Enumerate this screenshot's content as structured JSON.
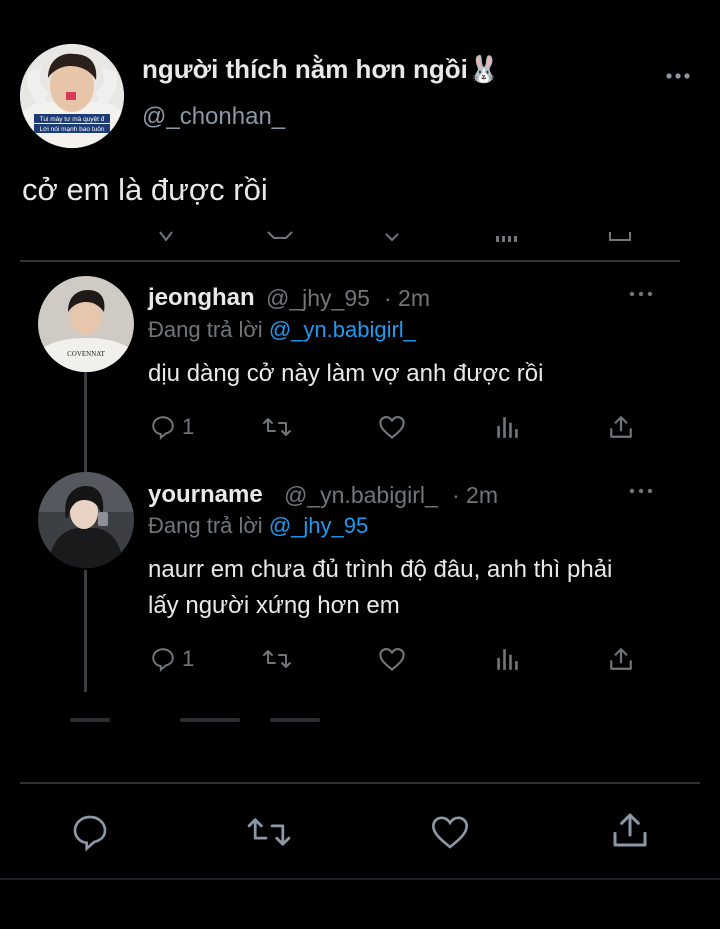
{
  "main_tweet": {
    "display_name": "người thích nằm hơn ngồi🐰",
    "handle": "@_chonhan_",
    "text": "cở em là được rồi",
    "avatar_caption_1": "Tui mày tư mà quyệt đ",
    "avatar_caption_2": "Lời nói mạnh bao tuôn"
  },
  "replies": [
    {
      "name": "jeonghan",
      "handle": "@_jhy_95",
      "time": "· 2m",
      "replying_label": "Đang trả lời",
      "replying_to": "@_yn.babigirl_",
      "text": "dịu dàng cở này làm vợ anh được rồi",
      "reply_count": "1",
      "avatar_shirt_text": "COVENNAT"
    },
    {
      "name": "yourname",
      "handle": "@_yn.babigirl_",
      "time": "· 2m",
      "replying_label": "Đang trả lời",
      "replying_to": "@_jhy_95",
      "text": "naurr em chưa đủ trình độ đâu, anh thì phải lấy người xứng hơn em",
      "reply_count": "1"
    }
  ],
  "icons": {
    "more": "more-horizontal-icon",
    "reply": "reply-icon",
    "retweet": "retweet-icon",
    "like": "heart-icon",
    "views": "views-icon",
    "share": "share-icon"
  },
  "colors": {
    "background": "#000000",
    "text": "#e7e9ea",
    "muted": "#71767b",
    "mention": "#1d9bf0",
    "divider": "#2f3336"
  }
}
